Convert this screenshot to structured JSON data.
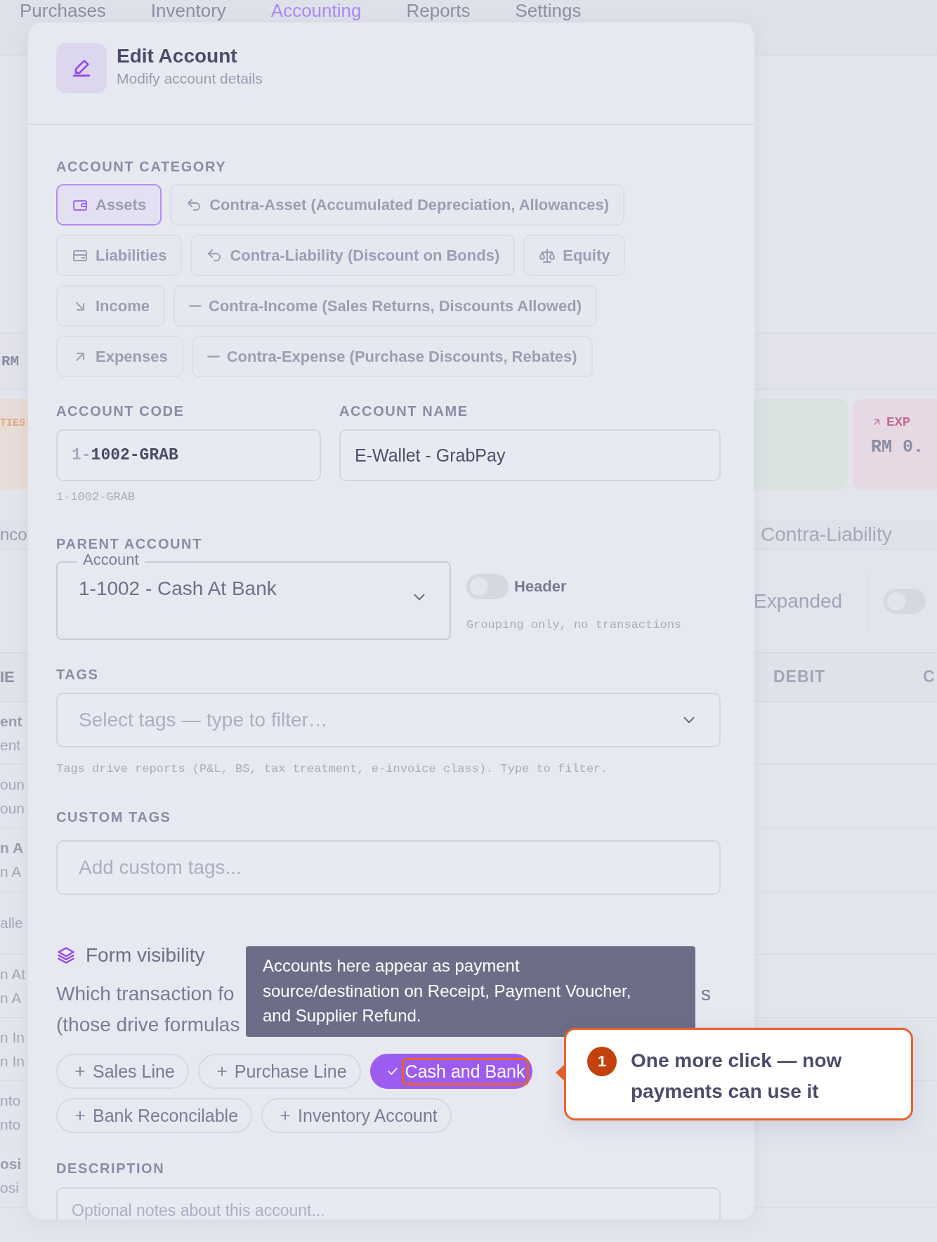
{
  "background": {
    "nav_tabs": [
      {
        "label": "Purchases",
        "selected": false
      },
      {
        "label": "Inventory",
        "selected": false
      },
      {
        "label": "Accounting",
        "selected": true
      },
      {
        "label": "Reports",
        "selected": false
      },
      {
        "label": "Settings",
        "selected": false
      }
    ],
    "summary_band": {
      "left": "RM"
    },
    "cards_left": [
      {
        "label": "TIES",
        "color": "#e7ddd6"
      }
    ],
    "cards_right": [
      {
        "color": "#d9e3e0"
      },
      {
        "label": "EXP",
        "value": "RM 0.",
        "color": "#e7d9e3"
      }
    ],
    "filter_row": {
      "left": "nco",
      "right": "Contra-Liability"
    },
    "toolbar": {
      "label": "Expanded",
      "toggle_on": false
    },
    "table": {
      "left_heading": "IE",
      "right_headings": [
        "DEBIT",
        "C"
      ],
      "rows": [
        {
          "lines": [
            "ent",
            "ent"
          ],
          "strong": true
        },
        {
          "lines": [
            "oun",
            "oun"
          ],
          "strong": false
        },
        {
          "lines": [
            "n A",
            "n A"
          ],
          "strong": true
        },
        {
          "lines": [
            "alle"
          ],
          "strong": false
        },
        {
          "lines": [
            "n At",
            "n A"
          ],
          "strong": false
        },
        {
          "lines": [
            "n In",
            "n In"
          ],
          "strong": false
        },
        {
          "lines": [
            "nto",
            "nto"
          ],
          "strong": false
        },
        {
          "lines": [
            "osi",
            "osi"
          ],
          "strong": true
        }
      ]
    }
  },
  "modal": {
    "title": "Edit Account",
    "subtitle": "Modify account details",
    "category": {
      "label": "ACCOUNT CATEGORY",
      "options": [
        {
          "label": "Assets",
          "kind": "wallet",
          "selected": true
        },
        {
          "label": "Contra-Asset (Accumulated Depreciation, Allowances)",
          "kind": "undo",
          "selected": false
        },
        {
          "label": "Liabilities",
          "kind": "card",
          "selected": false
        },
        {
          "label": "Contra-Liability (Discount on Bonds)",
          "kind": "undo",
          "selected": false
        },
        {
          "label": "Equity",
          "kind": "scale",
          "selected": false
        },
        {
          "label": "Income",
          "kind": "downright",
          "selected": false
        },
        {
          "label": "Contra-Income (Sales Returns, Discounts Allowed)",
          "kind": "minus",
          "selected": false
        },
        {
          "label": "Expenses",
          "kind": "upright",
          "selected": false
        },
        {
          "label": "Contra-Expense (Purchase Discounts, Rebates)",
          "kind": "minus",
          "selected": false
        }
      ]
    },
    "account_code": {
      "label": "ACCOUNT CODE",
      "prefix": "1-",
      "value": "1002-GRAB",
      "hint": "1-1002-GRAB"
    },
    "account_name": {
      "label": "ACCOUNT NAME",
      "value": "E-Wallet - GrabPay"
    },
    "parent_account": {
      "label": "PARENT ACCOUNT",
      "legend": "Account",
      "value": "1-1002 - Cash At Bank"
    },
    "header_toggle": {
      "label": "Header",
      "on": false,
      "hint": "Grouping only, no transactions"
    },
    "tags": {
      "label": "TAGS",
      "placeholder": "Select tags — type to filter…",
      "hint": "Tags drive reports (P&L, BS, tax treatment, e-invoice class). Type to filter."
    },
    "custom_tags": {
      "label": "CUSTOM TAGS",
      "placeholder": "Add custom tags..."
    },
    "form_visibility": {
      "title": "Form visibility",
      "line_1_start": "Which transaction fo",
      "line_1_end": "s",
      "line_2_start": "(those drive formulas",
      "options": [
        {
          "label": "Sales Line",
          "selected": false,
          "highlighted": false
        },
        {
          "label": "Purchase Line",
          "selected": false,
          "highlighted": false
        },
        {
          "label": "Cash and Bank",
          "selected": true,
          "highlighted": true
        },
        {
          "label": "Bank Reconcilable",
          "selected": false,
          "highlighted": false
        },
        {
          "label": "Inventory Account",
          "selected": false,
          "highlighted": false
        }
      ]
    },
    "tooltip": "Accounts here appear as payment source/destination on Receipt, Payment Voucher, and Supplier Refund.",
    "description": {
      "label": "DESCRIPTION",
      "placeholder": "Optional notes about this account..."
    }
  },
  "callout": {
    "step": "1",
    "text": "One more click — now payments can use it"
  }
}
